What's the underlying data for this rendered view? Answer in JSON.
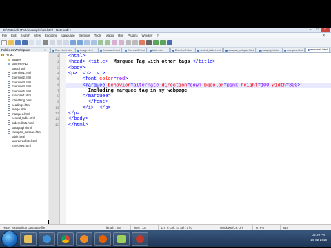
{
  "window": {
    "title": "E:\\Tutorial\\HTML\\examples\\a8.html - Notepad++"
  },
  "menu": [
    "File",
    "Edit",
    "Search",
    "View",
    "Encoding",
    "Language",
    "Settings",
    "Tools",
    "Macro",
    "Run",
    "Plugins",
    "Window",
    "?"
  ],
  "left_panel": {
    "title": "Folder as Workspace",
    "tree": [
      {
        "label": "HTML",
        "type": "folder",
        "level": 0
      },
      {
        "label": "images",
        "type": "folder",
        "level": 1
      },
      {
        "label": "banner.PNG",
        "type": "img",
        "level": 1
      },
      {
        "label": "basic.html",
        "type": "file",
        "level": 1
      },
      {
        "label": "Exercise1.html",
        "type": "file",
        "level": 1
      },
      {
        "label": "Exercise2.html",
        "type": "file",
        "level": 1
      },
      {
        "label": "Exercise3.html",
        "type": "file",
        "level": 1
      },
      {
        "label": "Exercise4.html",
        "type": "file",
        "level": 1
      },
      {
        "label": "Exercise5.html",
        "type": "file",
        "level": 1
      },
      {
        "label": "exercise7.html",
        "type": "file",
        "level": 1
      },
      {
        "label": "formatting.html",
        "type": "file",
        "level": 1
      },
      {
        "label": "headings.html",
        "type": "file",
        "level": 1
      },
      {
        "label": "image.html",
        "type": "file",
        "level": 1
      },
      {
        "label": "marquee.html",
        "type": "file",
        "level": 1
      },
      {
        "label": "nested_table.html",
        "type": "file",
        "level": 1
      },
      {
        "label": "orderedlists.html",
        "type": "file",
        "level": 1
      },
      {
        "label": "paragraph.html",
        "type": "file",
        "level": 1
      },
      {
        "label": "rowspan_colspan.html",
        "type": "file",
        "level": 1
      },
      {
        "label": "table.html",
        "type": "file",
        "level": 1
      },
      {
        "label": "unorderedlists.html",
        "type": "file",
        "level": 1
      },
      {
        "label": "exercise8.html",
        "type": "file",
        "level": 1
      }
    ]
  },
  "tabs": [
    {
      "label": "Exercise3.html",
      "active": false
    },
    {
      "label": "image.html",
      "active": false
    },
    {
      "label": "Exercise4.html",
      "active": false
    },
    {
      "label": "Exercise5.html",
      "active": false
    },
    {
      "label": "table.html",
      "active": false
    },
    {
      "label": "Exercise7.html",
      "active": false
    },
    {
      "label": "nested_table.html",
      "active": false
    },
    {
      "label": "rowspan_colspan.html",
      "active": false
    },
    {
      "label": "paragraph.html",
      "active": false
    },
    {
      "label": "marquee.html",
      "active": false
    },
    {
      "label": "exercise8.html",
      "active": true
    }
  ],
  "code_lines": [
    {
      "n": "1",
      "parts": [
        {
          "c": "tag",
          "t": "<html>"
        }
      ]
    },
    {
      "n": "2",
      "parts": [
        {
          "c": "tag",
          "t": "<head>"
        },
        {
          "c": "",
          "t": " "
        },
        {
          "c": "tag",
          "t": "<title>"
        },
        {
          "c": "txt",
          "t": "  Marquee Tag with other tags "
        },
        {
          "c": "tag",
          "t": "</title>"
        }
      ]
    },
    {
      "n": "3",
      "parts": [
        {
          "c": "tag",
          "t": "<body>"
        }
      ]
    },
    {
      "n": "4",
      "parts": [
        {
          "c": "tag",
          "t": "<p>"
        },
        {
          "c": "",
          "t": "  "
        },
        {
          "c": "tag",
          "t": "<b>"
        },
        {
          "c": "",
          "t": "  "
        },
        {
          "c": "tag",
          "t": "<i>"
        }
      ]
    },
    {
      "n": "5",
      "parts": [
        {
          "c": "",
          "t": "     "
        },
        {
          "c": "tag",
          "t": "<font "
        },
        {
          "c": "attr",
          "t": "color"
        },
        {
          "c": "tag",
          "t": "="
        },
        {
          "c": "val",
          "t": "red"
        },
        {
          "c": "tag",
          "t": ">"
        }
      ]
    },
    {
      "n": "6",
      "hl": true,
      "parts": [
        {
          "c": "",
          "t": "     "
        },
        {
          "c": "tag",
          "t": "<marquee "
        },
        {
          "c": "attr",
          "t": "behavior"
        },
        {
          "c": "tag",
          "t": "="
        },
        {
          "c": "val",
          "t": "alternate"
        },
        {
          "c": "tag",
          "t": " "
        },
        {
          "c": "attr",
          "t": "direction"
        },
        {
          "c": "tag",
          "t": "="
        },
        {
          "c": "val",
          "t": "down"
        },
        {
          "c": "tag",
          "t": " "
        },
        {
          "c": "attr",
          "t": "bgcolor"
        },
        {
          "c": "tag",
          "t": "="
        },
        {
          "c": "val",
          "t": "pink"
        },
        {
          "c": "tag",
          "t": " "
        },
        {
          "c": "attr",
          "t": "height"
        },
        {
          "c": "tag",
          "t": "="
        },
        {
          "c": "val",
          "t": "100"
        },
        {
          "c": "tag",
          "t": " "
        },
        {
          "c": "attr",
          "t": "width"
        },
        {
          "c": "tag",
          "t": "="
        },
        {
          "c": "val",
          "t": "300"
        },
        {
          "c": "tag",
          "t": ">"
        }
      ]
    },
    {
      "n": "7",
      "parts": [
        {
          "c": "",
          "t": "       "
        },
        {
          "c": "txt",
          "t": "Including marquee tag in my webpage"
        }
      ]
    },
    {
      "n": "8",
      "parts": [
        {
          "c": "",
          "t": "     "
        },
        {
          "c": "tag",
          "t": "</marquee>"
        }
      ]
    },
    {
      "n": "9",
      "parts": [
        {
          "c": "",
          "t": "       "
        },
        {
          "c": "tag",
          "t": "</font>"
        }
      ]
    },
    {
      "n": "10",
      "parts": [
        {
          "c": "",
          "t": "     "
        },
        {
          "c": "tag",
          "t": "</i>"
        },
        {
          "c": "",
          "t": "  "
        },
        {
          "c": "tag",
          "t": "</b>"
        }
      ]
    },
    {
      "n": "11",
      "parts": [
        {
          "c": "tag",
          "t": "</p>"
        }
      ]
    },
    {
      "n": "12",
      "parts": [
        {
          "c": "tag",
          "t": "</body>"
        }
      ]
    },
    {
      "n": "13",
      "parts": [
        {
          "c": "tag",
          "t": "</html>"
        }
      ]
    }
  ],
  "status": {
    "lang": "Hyper Text Markup Language file",
    "length": "length : 284",
    "lines": "lines : 13",
    "pos": "Ln : 6   Col : 47   Sel : 0 | 0",
    "eol": "Windows (CR LF)",
    "enc": "UTF-8",
    "mode": "INS"
  },
  "tray": {
    "time": "06:29 PM",
    "date": "26-02-2019"
  },
  "colors": {
    "tag": "#0000ff",
    "attr": "#ff0000",
    "value": "#8000ff",
    "current_line": "#e8e8ff"
  }
}
